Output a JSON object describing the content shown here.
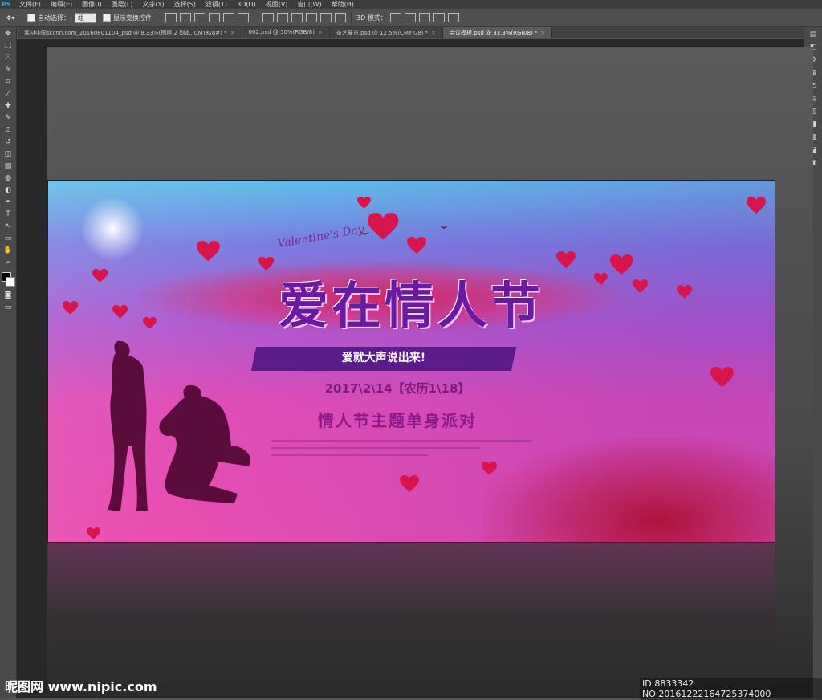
{
  "app": {
    "logo": "PS",
    "menu": [
      "文件(F)",
      "编辑(E)",
      "图像(I)",
      "图层(L)",
      "文字(Y)",
      "选择(S)",
      "滤镜(T)",
      "3D(D)",
      "视图(V)",
      "窗口(W)",
      "帮助(H)"
    ]
  },
  "options": {
    "auto_select_label": "自动选择：",
    "auto_select_value": "组",
    "show_transform_label": "显示变换控件",
    "mode_label": "3D 模式："
  },
  "tabs": [
    {
      "label": "素材中国sccnn.com_20160801104_psd @ 8.33%(图层 2 副本, CMYK/8#) *",
      "active": false
    },
    {
      "label": "002.psd @ 50%(RGB/8)",
      "active": false
    },
    {
      "label": "茶艺展览.psd @ 12.5%(CMYK/8) *",
      "active": false
    },
    {
      "label": "会议模板.psd @ 33.3%(RGB/8) *",
      "active": true
    }
  ],
  "tools": [
    "move-icon",
    "marquee-icon",
    "lasso-icon",
    "quick-select-icon",
    "crop-icon",
    "eyedropper-icon",
    "healing-icon",
    "brush-icon",
    "stamp-icon",
    "history-brush-icon",
    "eraser-icon",
    "gradient-icon",
    "blur-icon",
    "dodge-icon",
    "pen-icon",
    "type-icon",
    "path-select-icon",
    "shape-icon",
    "hand-icon",
    "zoom-icon"
  ],
  "tool_glyphs": [
    "✥",
    "⬚",
    "ʘ",
    "✎",
    "⌗",
    "⁄",
    "✚",
    "✎",
    "⊙",
    "↺",
    "◫",
    "▤",
    "◍",
    "◐",
    "✒",
    "T",
    "↖",
    "▭",
    "✋",
    "⌕"
  ],
  "right_panel_glyphs": [
    "▤",
    "◧",
    "⚙",
    "▦",
    "◩",
    "▤",
    "▥",
    "◨",
    "▩",
    "◪",
    "▣"
  ],
  "artwork": {
    "title": "爱在情人节",
    "script_title": "Valentine's Day",
    "slogan": "爱就大声说出来!",
    "date": "2017\\2\\14【农历1\\18】",
    "subtitle": "情人节主题单身派对"
  },
  "watermark": {
    "left": "昵图网 www.nipic.com",
    "right": "ID:8833342 NO:20161222164725374000"
  },
  "colors": {
    "heart": "#d8144a",
    "title": "#6a1aa0"
  }
}
